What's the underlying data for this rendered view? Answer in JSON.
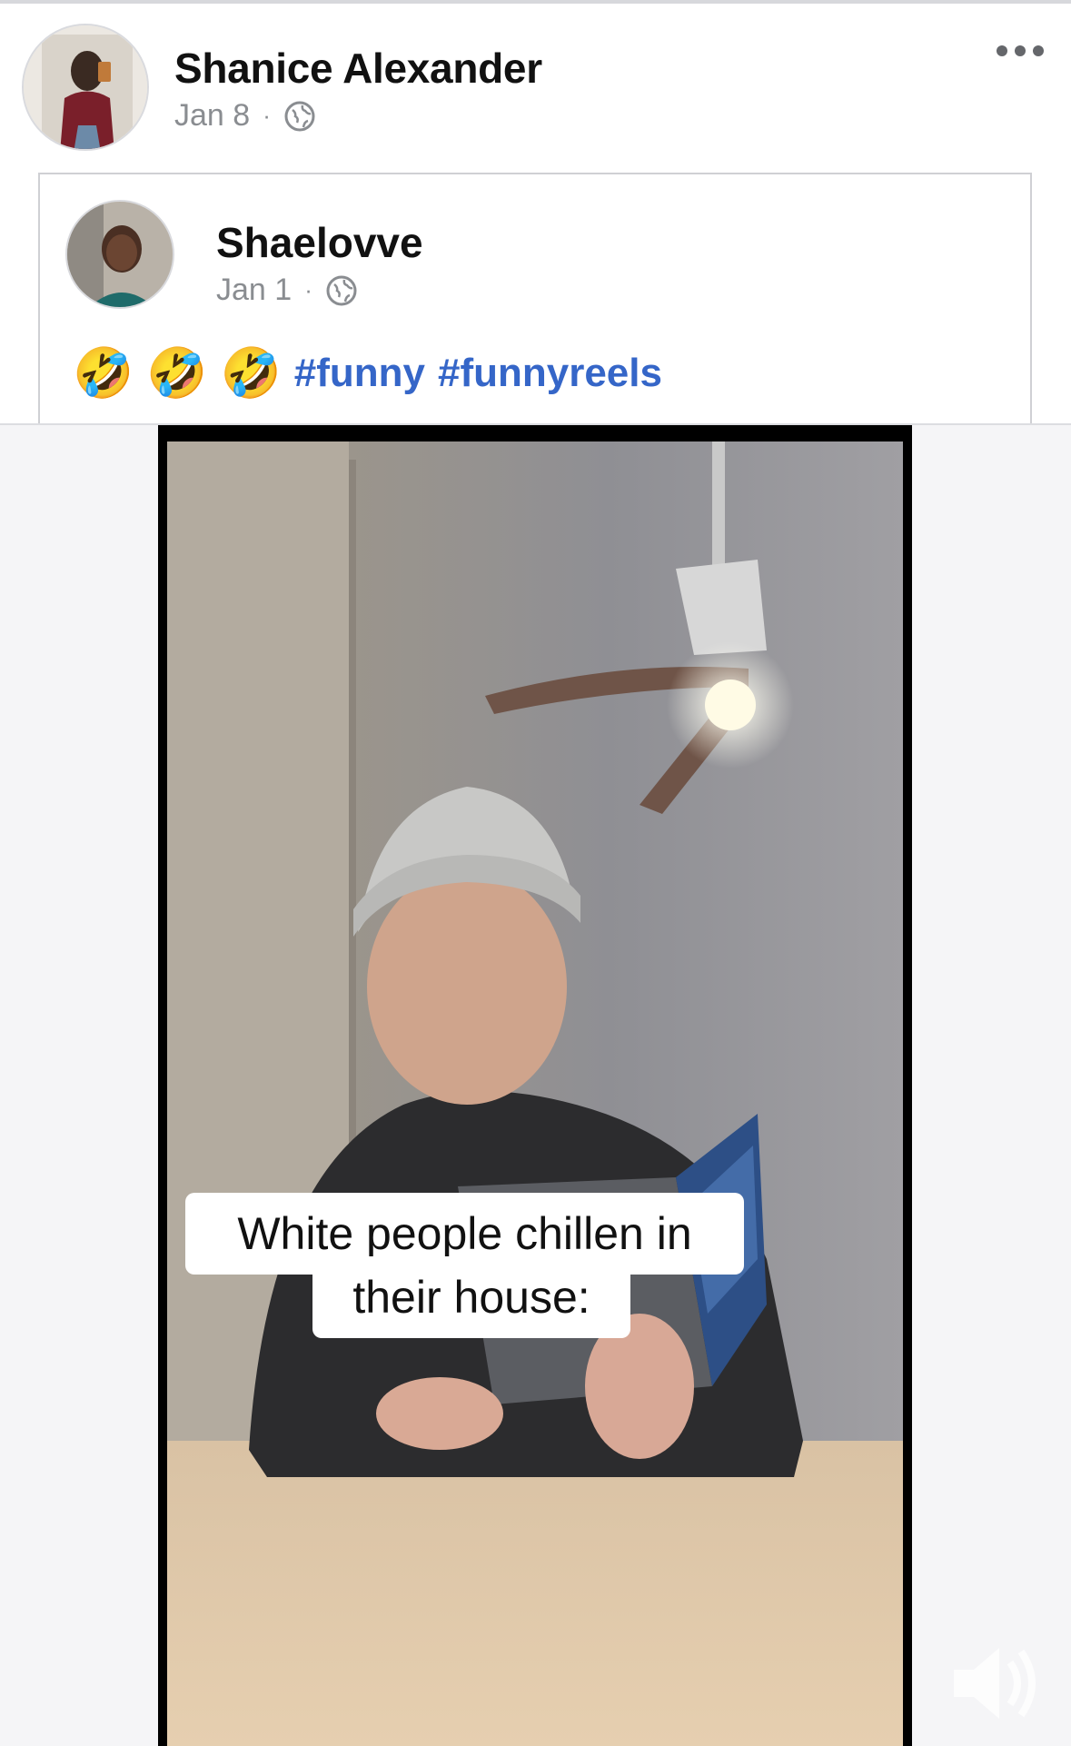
{
  "post": {
    "author": "Shanice Alexander",
    "date": "Jan 8",
    "separator": "·"
  },
  "shared": {
    "author": "Shaelovve",
    "date": "Jan 1",
    "separator": "·",
    "emojis": [
      "🤣",
      "🤣",
      "🤣"
    ],
    "hashtags": [
      "#funny",
      "#funnyreels"
    ]
  },
  "video": {
    "caption_line1": "White people chillen in",
    "caption_line2": "their house:"
  },
  "icons": {
    "privacy": "globe-icon",
    "more": "more-options-icon",
    "volume": "volume-icon"
  },
  "colors": {
    "link": "#3566c8",
    "meta": "#8a8d91"
  }
}
